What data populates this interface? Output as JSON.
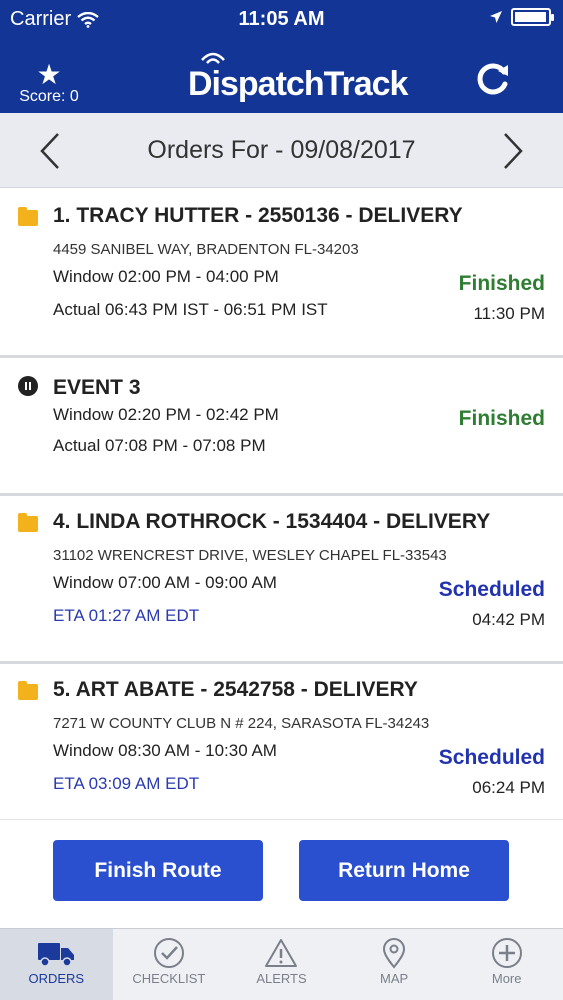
{
  "statusbar": {
    "carrier": "Carrier",
    "time": "11:05 AM"
  },
  "header": {
    "score_label": "Score: 0",
    "logo_text": "DispatchTrack"
  },
  "datebar": {
    "title": "Orders For - 09/08/2017"
  },
  "orders": [
    {
      "name": "1. TRACY HUTTER - 2550136 - DELIVERY",
      "address": "4459 SANIBEL WAY, BRADENTON FL-34203",
      "window": "Window 02:00 PM - 04:00 PM",
      "actual": "Actual 06:43 PM IST - 06:51 PM IST",
      "status": "Finished",
      "status_time": "11:30 PM",
      "icon": "folder-icon"
    },
    {
      "name": "EVENT 3",
      "window": "Window 02:20 PM - 02:42 PM",
      "actual": "Actual 07:08 PM - 07:08 PM",
      "status": "Finished",
      "icon": "pause-icon"
    },
    {
      "name": "4. LINDA ROTHROCK - 1534404 - DELIVERY",
      "address": "31102 WRENCREST DRIVE, WESLEY CHAPEL FL-33543",
      "window": "Window 07:00 AM - 09:00 AM",
      "eta": "ETA 01:27 AM EDT",
      "status": "Scheduled",
      "status_time": "04:42 PM",
      "icon": "folder-icon"
    },
    {
      "name": "5. ART ABATE - 2542758 - DELIVERY",
      "address": "7271 W COUNTY CLUB N # 224, SARASOTA FL-34243",
      "window": "Window 08:30 AM - 10:30 AM",
      "eta": "ETA 03:09 AM EDT",
      "status": "Scheduled",
      "status_time": "06:24 PM",
      "icon": "folder-icon"
    }
  ],
  "actions": {
    "finish_route": "Finish Route",
    "return_home": "Return Home"
  },
  "tabs": [
    {
      "label": "ORDERS",
      "icon": "truck-icon",
      "active": true
    },
    {
      "label": "CHECKLIST",
      "icon": "checkmark-circle-icon"
    },
    {
      "label": "ALERTS",
      "icon": "warning-triangle-icon"
    },
    {
      "label": "MAP",
      "icon": "map-pin-icon"
    },
    {
      "label": "More",
      "icon": "plus-circle-icon"
    }
  ],
  "colors": {
    "header_bg": "#123596",
    "finished": "#2e7d32",
    "scheduled": "#2233b0",
    "button_bg": "#2a4fcf",
    "folder": "#f3b21b"
  }
}
